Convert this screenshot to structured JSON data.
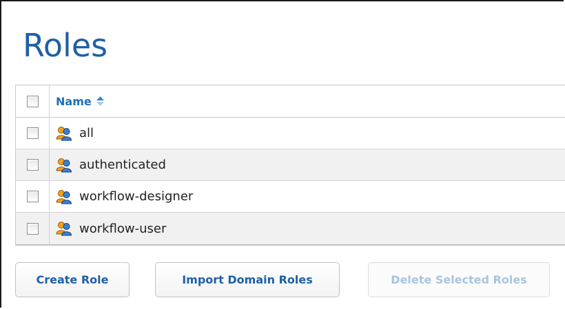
{
  "page": {
    "title": "Roles"
  },
  "table": {
    "header": {
      "name_label": "Name"
    },
    "rows": [
      {
        "label": "all"
      },
      {
        "label": "authenticated"
      },
      {
        "label": "workflow-designer"
      },
      {
        "label": "workflow-user"
      }
    ]
  },
  "actions": {
    "create": "Create Role",
    "import": "Import Domain Roles",
    "delete": "Delete Selected Roles"
  },
  "colors": {
    "title": "#1f5fa6",
    "link": "#1f6fb8",
    "disabled": "#a9c4e0",
    "row_alt": "#f1f1f1"
  }
}
